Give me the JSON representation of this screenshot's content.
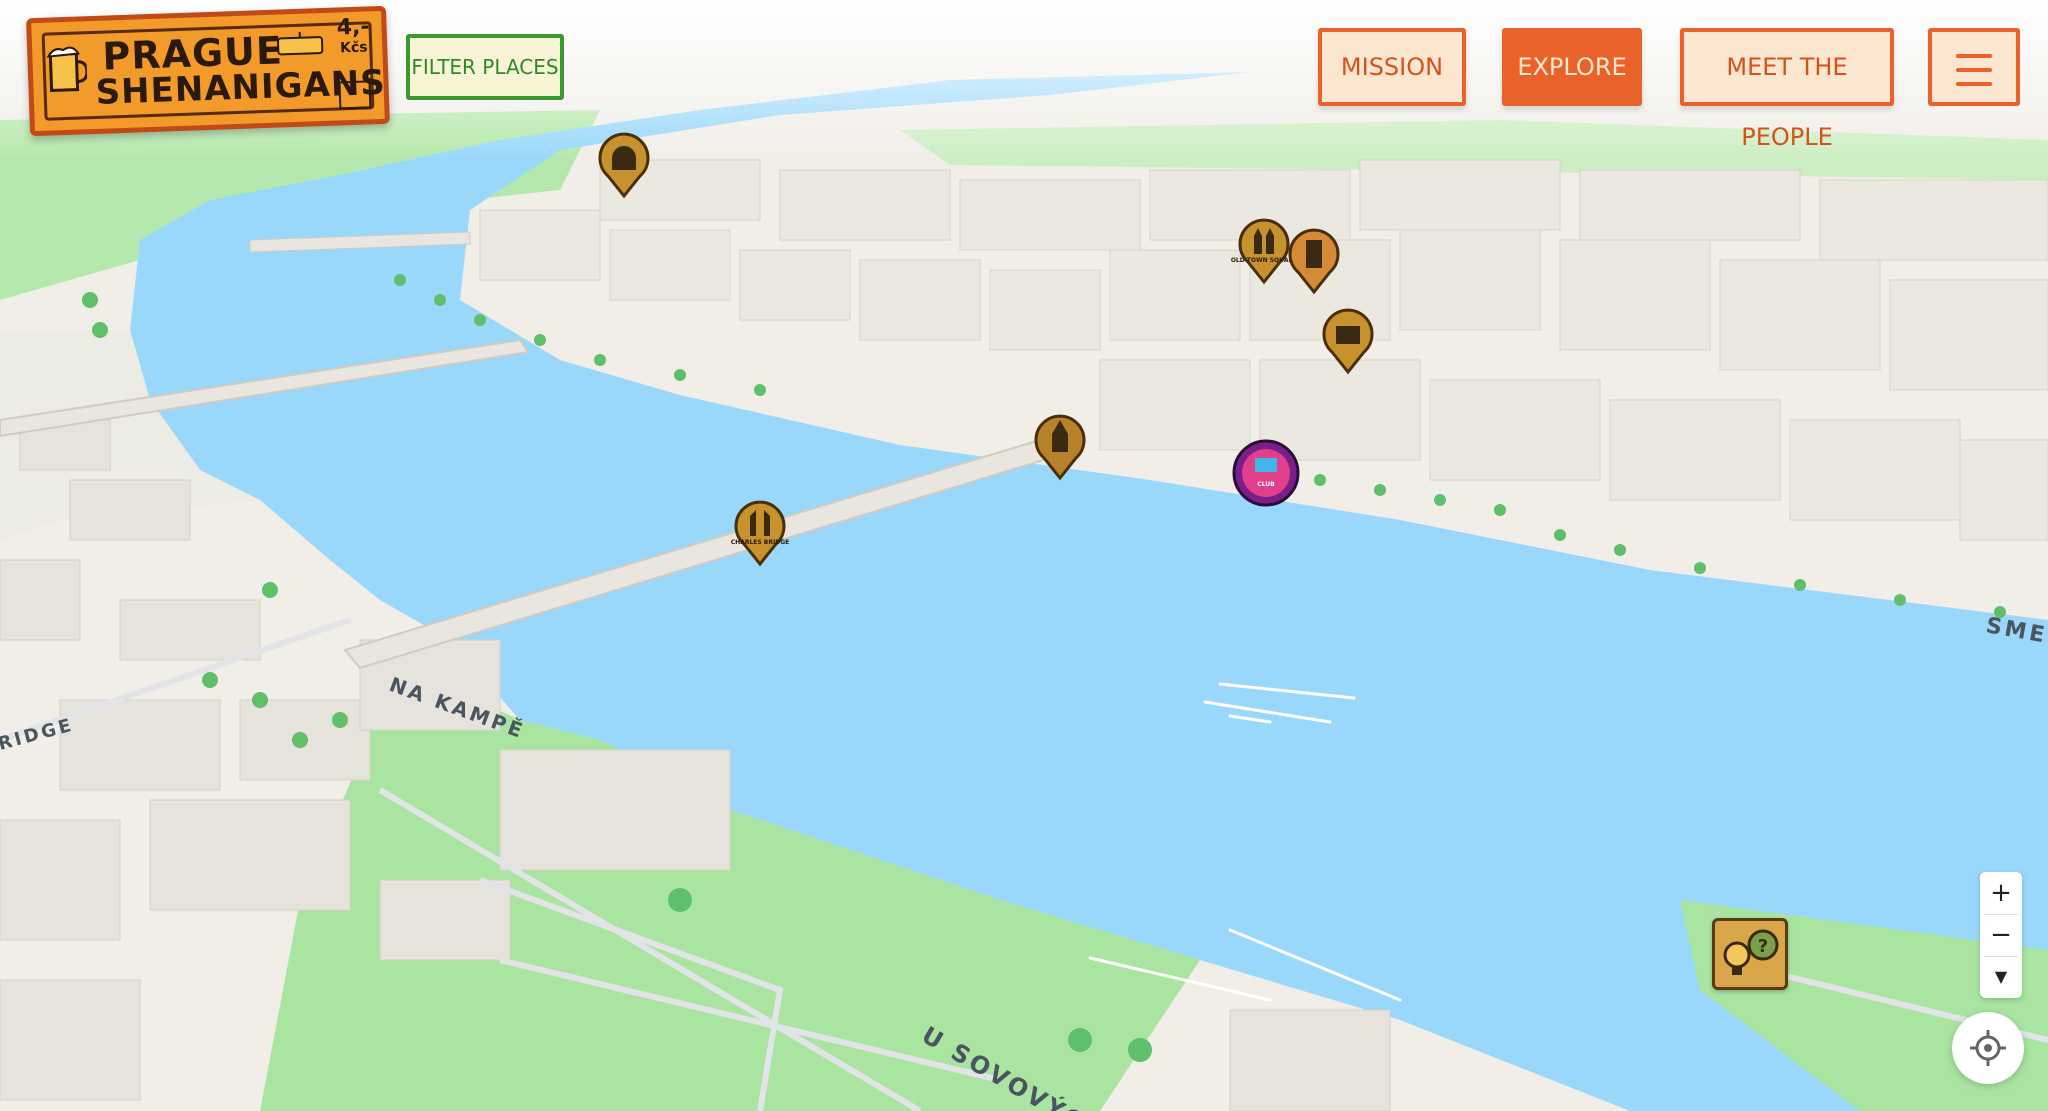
{
  "brand": {
    "line1": "PRAGUE",
    "line2": "SHENANIGANS",
    "price": "4,-",
    "currency": "Kčs"
  },
  "toolbar": {
    "filter_label": "FILTER PLACES"
  },
  "nav": {
    "items": [
      {
        "label": "MISSION"
      },
      {
        "label": "EXPLORE"
      },
      {
        "label": "MEET THE PEOPLE"
      }
    ],
    "active": "EXPLORE"
  },
  "map": {
    "street_labels": [
      "NA KAMPĚ",
      "U SOVOVÝCH",
      "RIDGE",
      "SMET"
    ],
    "markers": [
      {
        "name": "tunnel-marker",
        "label": ""
      },
      {
        "name": "old-town-square-marker",
        "label": "OLD TOWN SQUARE"
      },
      {
        "name": "tower-marker",
        "label": ""
      },
      {
        "name": "theatre-marker",
        "label": ""
      },
      {
        "name": "church-marker",
        "label": ""
      },
      {
        "name": "club-marker",
        "label": "CLUB"
      },
      {
        "name": "charles-bridge-marker",
        "label": "CHARLES BRIDGE"
      }
    ]
  },
  "controls": {
    "zoom_in": "+",
    "zoom_out": "−",
    "compass": "▼"
  },
  "colors": {
    "accent": "#e8622a",
    "filter": "#3a9a2f",
    "water": "#9ad8fb",
    "park": "#a9e5a1",
    "building": "#ece9e1",
    "marker": "#c7922e"
  }
}
